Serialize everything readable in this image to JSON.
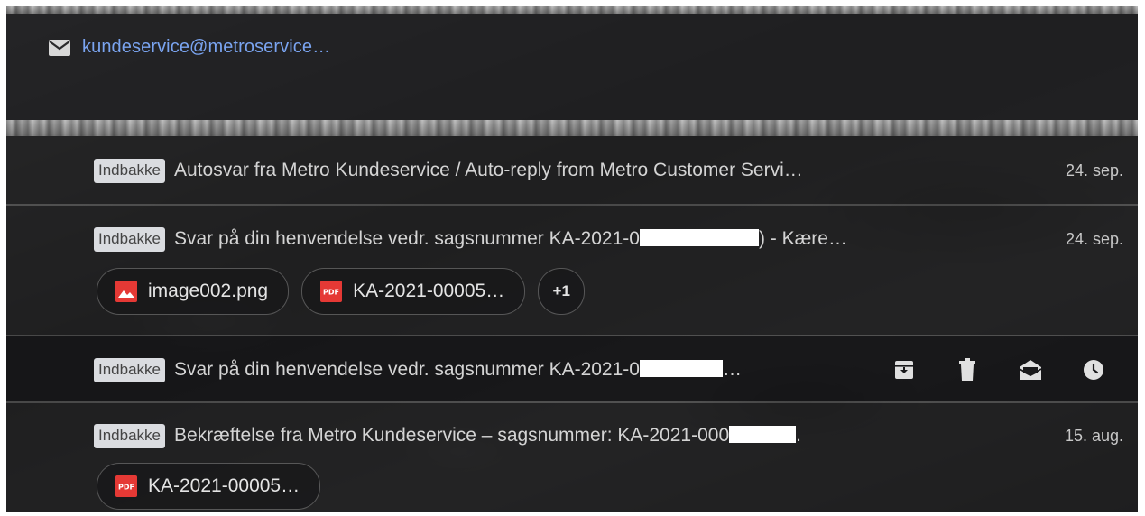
{
  "account": {
    "email": "kundeservice@metroservice…",
    "icon": "mail-icon",
    "color": "#7aa4f0"
  },
  "emails": [
    {
      "label": "Indbakke",
      "subject": "Autosvar fra Metro Kundeservice / Auto-reply from Metro Customer Servi…",
      "date": "24. sep."
    },
    {
      "label": "Indbakke",
      "subject_before": "Svar på din henvendelse vedr. sagsnummer KA-2021-0",
      "subject_after": ") - Kære…",
      "date": "24. sep.",
      "attachments": [
        {
          "name": "image002.png",
          "icon": "image-file-icon",
          "color": "#e53935"
        },
        {
          "name": "KA-2021-00005…",
          "icon": "pdf-file-icon",
          "color": "#e53935"
        }
      ],
      "more_attachments": "+1"
    },
    {
      "label": "Indbakke",
      "subject_before": "Svar på din henvendelse vedr. sagsnummer KA-2021-0",
      "subject_after": "…",
      "actions": [
        "archive-icon",
        "delete-icon",
        "mark-unread-icon",
        "snooze-icon"
      ]
    },
    {
      "label": "Indbakke",
      "subject_before": "Bekræftelse fra Metro Kundeservice – sagsnummer: KA-2021-000",
      "subject_after": ".",
      "date": "15. aug.",
      "attachments": [
        {
          "name": "KA-2021-00005…",
          "icon": "pdf-file-icon",
          "color": "#e53935"
        }
      ]
    }
  ]
}
